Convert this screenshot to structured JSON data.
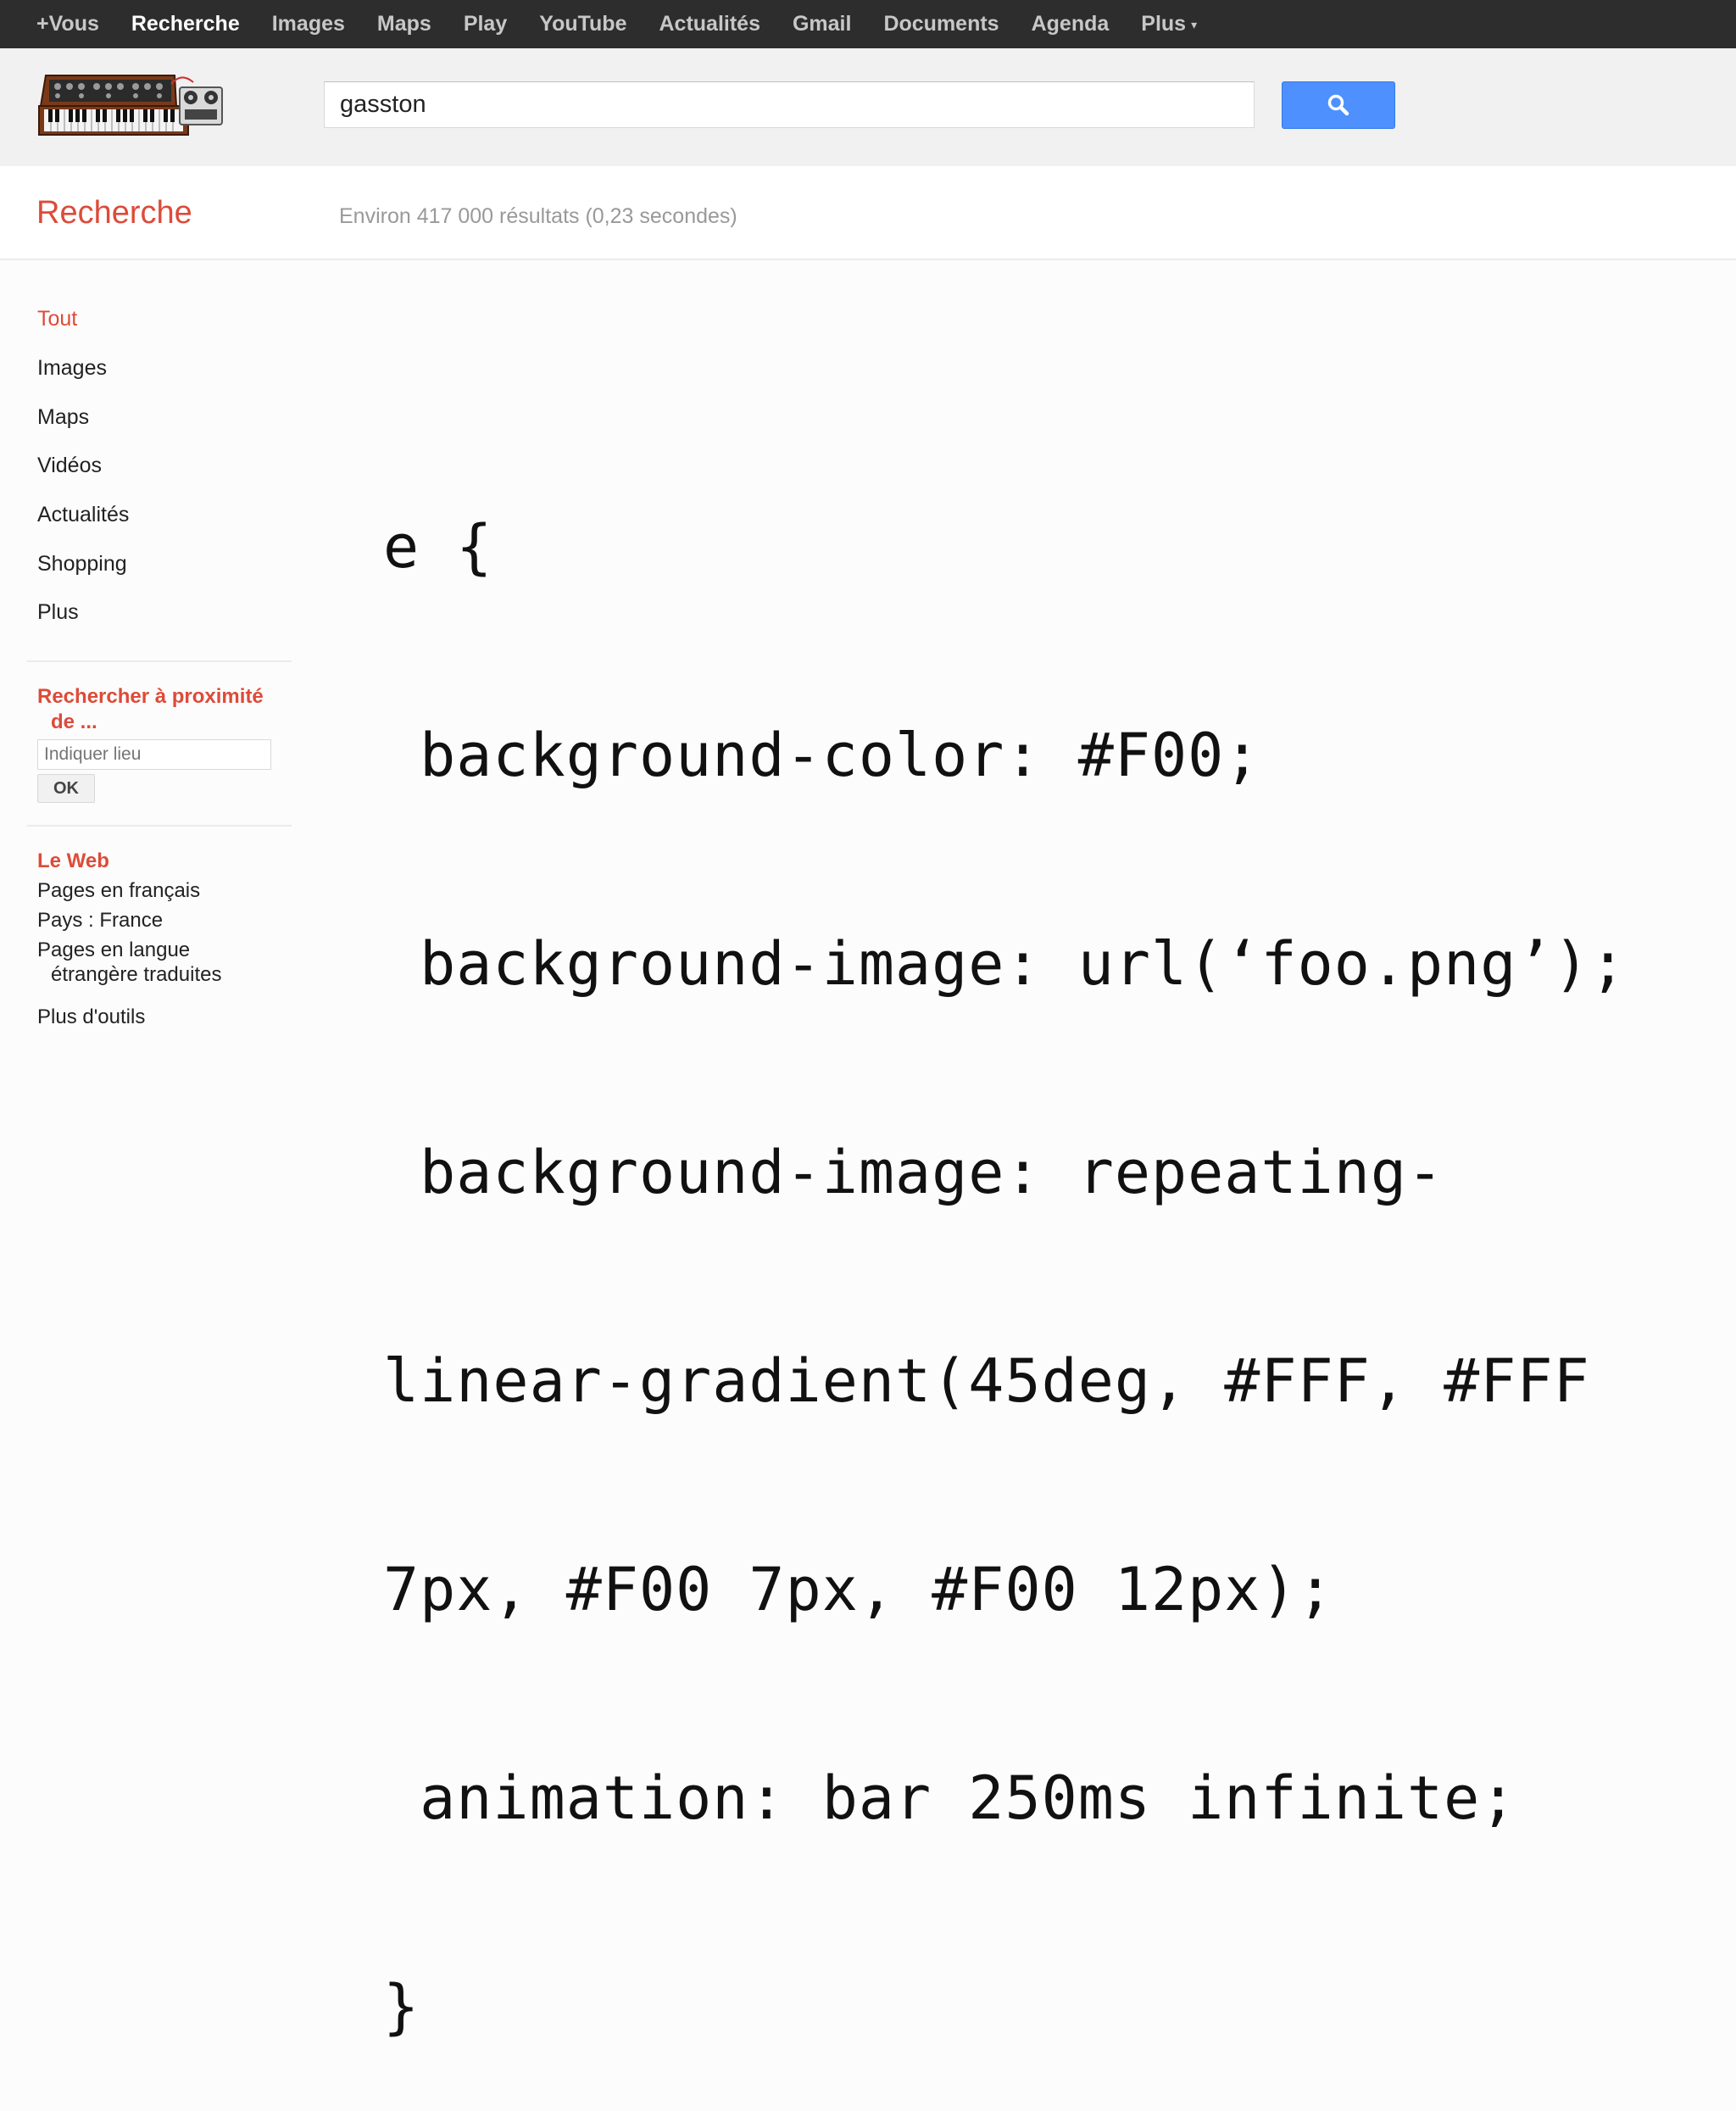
{
  "topbar": {
    "items": [
      "+Vous",
      "Recherche",
      "Images",
      "Maps",
      "Play",
      "YouTube",
      "Actualités",
      "Gmail",
      "Documents",
      "Agenda",
      "Plus"
    ]
  },
  "search": {
    "query": "gasston"
  },
  "subheader": {
    "title": "Recherche",
    "stats": "Environ 417 000 résultats (0,23 secondes)"
  },
  "leftnav": {
    "items": [
      "Tout",
      "Images",
      "Maps",
      "Vidéos",
      "Actualités",
      "Shopping",
      "Plus"
    ],
    "nearby_heading_line1": "Rechercher à proximité",
    "nearby_heading_line2": "de ...",
    "place_placeholder": "Indiquer lieu",
    "ok_label": "OK",
    "web_heading": "Le Web",
    "tools": [
      "Pages en français",
      "Pays : France",
      "Pages en langue",
      "étrangère traduites",
      "Plus d'outils"
    ]
  },
  "code": {
    "lines": [
      "e {",
      " background-color: #F00;",
      " background-image: url(‘foo.png’);",
      " background-image: repeating-",
      "linear-gradient(45deg, #FFF, #FFF",
      "7px, #F00 7px, #F00 12px);",
      " animation: bar 250ms infinite;",
      "}"
    ]
  },
  "colors": {
    "topbar_bg": "#2d2d2d",
    "accent_red": "#dd4b39",
    "search_blue": "#4d90fe"
  }
}
